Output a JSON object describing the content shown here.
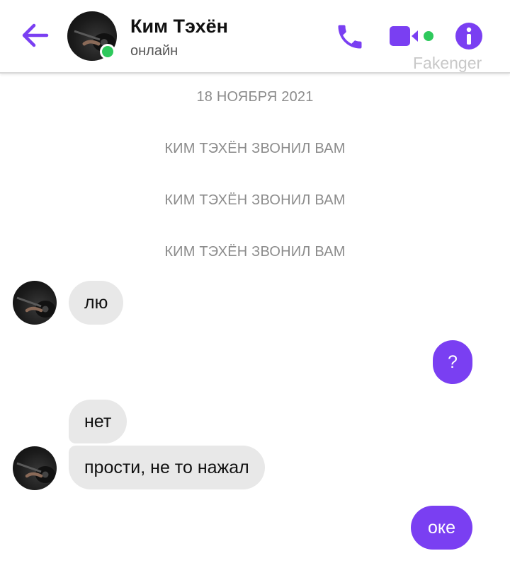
{
  "header": {
    "contact_name": "Ким Тэхён",
    "status": "онлайн",
    "watermark": "Fakenger"
  },
  "colors": {
    "accent": "#7a3ff2",
    "online": "#2ec95c",
    "incoming_bubble": "#e8e8e8"
  },
  "icons": {
    "back": "arrow-left-icon",
    "call": "phone-icon",
    "video": "video-camera-icon",
    "info": "info-icon"
  },
  "chat": {
    "date": "18 НОЯБРЯ 2021",
    "system_1": "КИМ ТЭХЁН ЗВОНИЛ ВАМ",
    "system_2": "КИМ ТЭХЁН ЗВОНИЛ ВАМ",
    "system_3": "КИМ ТЭХЁН ЗВОНИЛ ВАМ",
    "msg_1": "лю",
    "msg_2": "?",
    "msg_3": "нет",
    "msg_4": "прости, не то нажал",
    "msg_5": "оке"
  }
}
